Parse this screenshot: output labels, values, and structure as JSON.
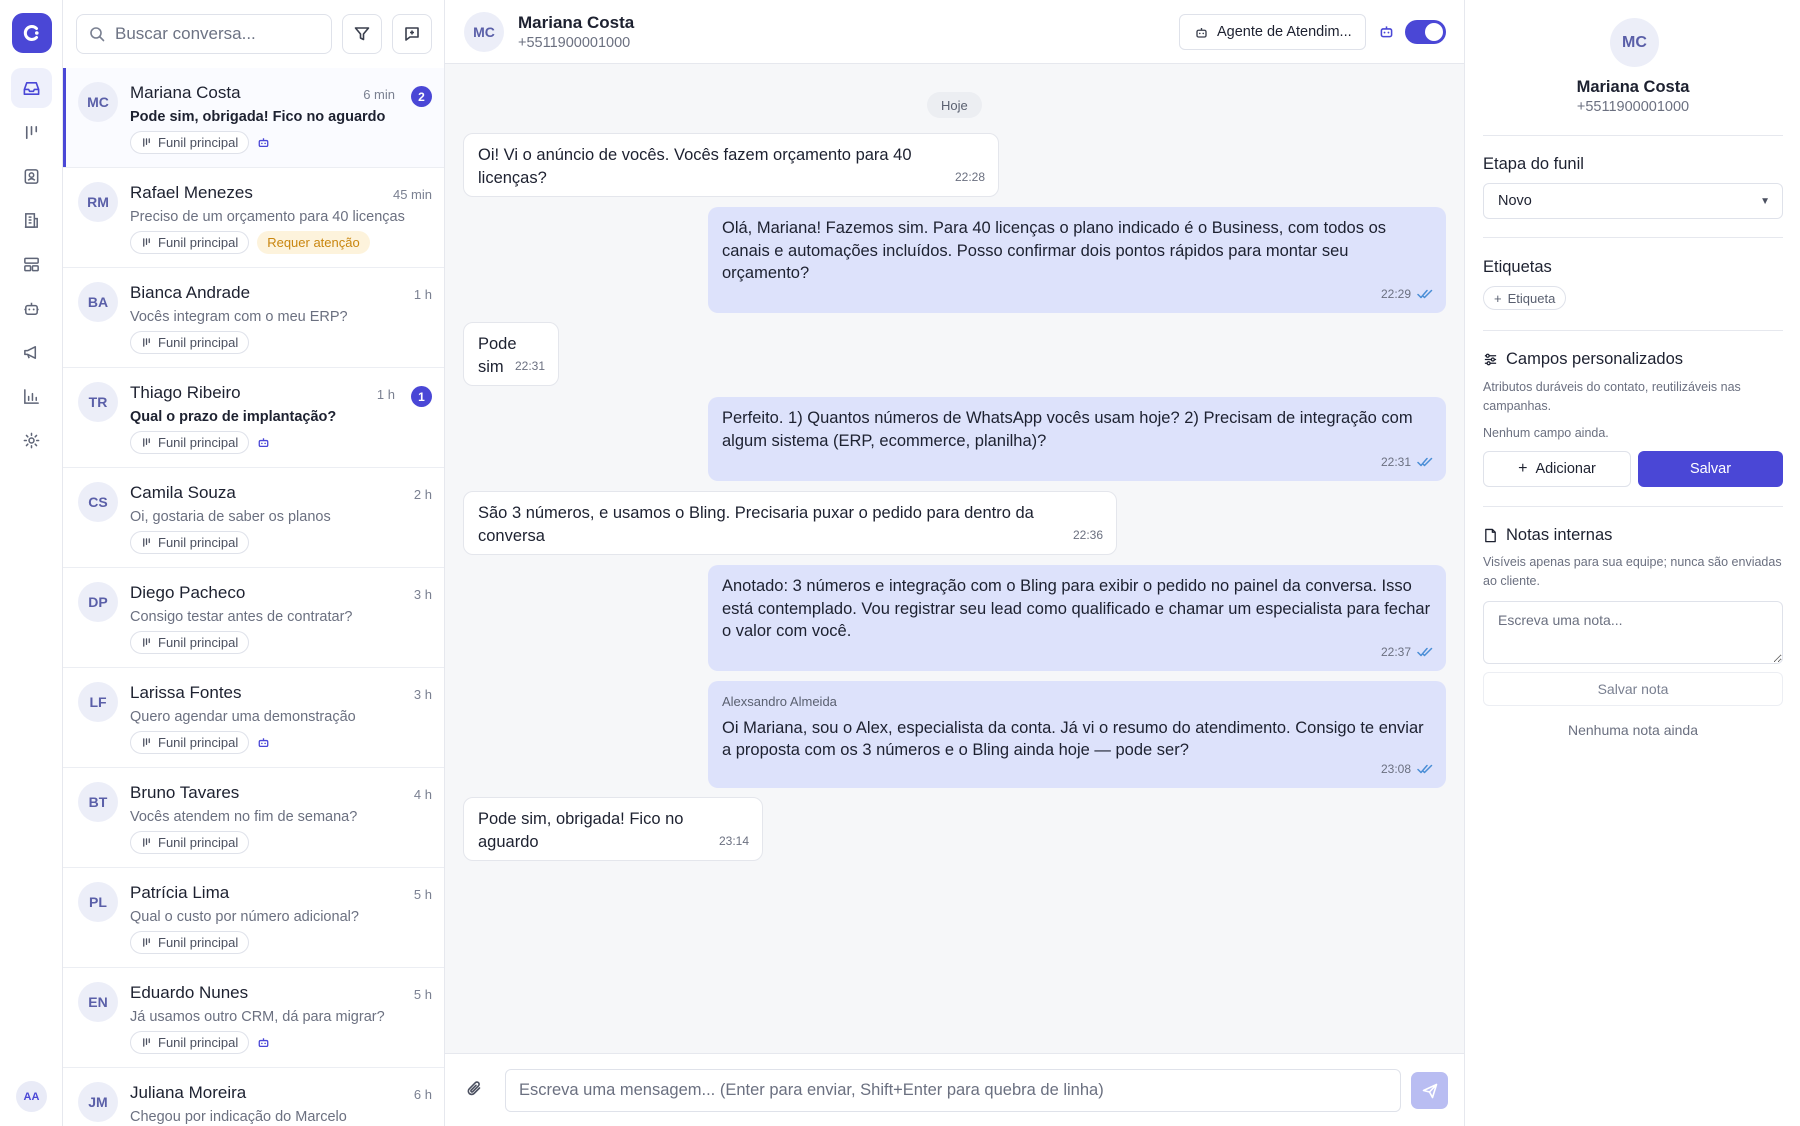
{
  "rail": {
    "nav_icons": [
      "inbox-icon",
      "pipeline-icon",
      "contacts-icon",
      "company-icon",
      "templates-icon",
      "bot-icon",
      "megaphone-icon",
      "reports-icon",
      "gear-icon"
    ],
    "user_initials": "AA"
  },
  "conv_list": {
    "search_placeholder": "Buscar conversa...",
    "items": [
      {
        "initials": "MC",
        "name": "Mariana Costa",
        "time": "6 min",
        "unread": "2",
        "preview": "Pode sim, obrigada! Fico no aguardo",
        "tag": "Funil principal",
        "bot": true,
        "warn": ""
      },
      {
        "initials": "RM",
        "name": "Rafael Menezes",
        "time": "45 min",
        "unread": "",
        "preview": "Preciso de um orçamento para 40 licenças",
        "tag": "Funil principal",
        "bot": false,
        "warn": "Requer atenção"
      },
      {
        "initials": "BA",
        "name": "Bianca Andrade",
        "time": "1 h",
        "unread": "",
        "preview": "Vocês integram com o meu ERP?",
        "tag": "Funil principal",
        "bot": false,
        "warn": ""
      },
      {
        "initials": "TR",
        "name": "Thiago Ribeiro",
        "time": "1 h",
        "unread": "1",
        "preview": "Qual o prazo de implantação?",
        "tag": "Funil principal",
        "bot": true,
        "warn": ""
      },
      {
        "initials": "CS",
        "name": "Camila Souza",
        "time": "2 h",
        "unread": "",
        "preview": "Oi, gostaria de saber os planos",
        "tag": "Funil principal",
        "bot": false,
        "warn": ""
      },
      {
        "initials": "DP",
        "name": "Diego Pacheco",
        "time": "3 h",
        "unread": "",
        "preview": "Consigo testar antes de contratar?",
        "tag": "Funil principal",
        "bot": false,
        "warn": ""
      },
      {
        "initials": "LF",
        "name": "Larissa Fontes",
        "time": "3 h",
        "unread": "",
        "preview": "Quero agendar uma demonstração",
        "tag": "Funil principal",
        "bot": true,
        "warn": ""
      },
      {
        "initials": "BT",
        "name": "Bruno Tavares",
        "time": "4 h",
        "unread": "",
        "preview": "Vocês atendem no fim de semana?",
        "tag": "Funil principal",
        "bot": false,
        "warn": ""
      },
      {
        "initials": "PL",
        "name": "Patrícia Lima",
        "time": "5 h",
        "unread": "",
        "preview": "Qual o custo por número adicional?",
        "tag": "Funil principal",
        "bot": false,
        "warn": ""
      },
      {
        "initials": "EN",
        "name": "Eduardo Nunes",
        "time": "5 h",
        "unread": "",
        "preview": "Já usamos outro CRM, dá para migrar?",
        "tag": "Funil principal",
        "bot": true,
        "warn": ""
      },
      {
        "initials": "JM",
        "name": "Juliana Moreira",
        "time": "6 h",
        "unread": "",
        "preview": "Chegou por indicação do Marcelo",
        "tag": "Funil principal",
        "bot": false,
        "warn": ""
      }
    ]
  },
  "chat": {
    "contact_initials": "MC",
    "contact_name": "Mariana Costa",
    "contact_phone": "+5511900001000",
    "agent_label": "Agente de Atendim...",
    "day_label": "Hoje",
    "messages": [
      {
        "dir": "in",
        "text": "Oi! Vi o anúncio de vocês. Vocês fazem orçamento para 40 licenças?",
        "time": "22:28"
      },
      {
        "dir": "out",
        "text": "Olá, Mariana! Fazemos sim. Para 40 licenças o plano indicado é o Business, com todos os canais e automações incluídos. Posso confirmar dois pontos rápidos para montar seu orçamento?",
        "time": "22:29"
      },
      {
        "dir": "in",
        "text": "Pode sim",
        "time": "22:31"
      },
      {
        "dir": "out",
        "text": "Perfeito. 1) Quantos números de WhatsApp vocês usam hoje? 2) Precisam de integração com algum sistema (ERP, ecommerce, planilha)?",
        "time": "22:31"
      },
      {
        "dir": "in",
        "text": "São 3 números, e usamos o Bling. Precisaria puxar o pedido para dentro da conversa",
        "time": "22:36"
      },
      {
        "dir": "out",
        "text": "Anotado: 3 números e integração com o Bling para exibir o pedido no painel da conversa. Isso está contemplado. Vou registrar seu lead como qualificado e chamar um especialista para fechar o valor com você.",
        "time": "22:37"
      },
      {
        "dir": "out",
        "author": "Alexsandro Almeida",
        "text": "Oi Mariana, sou o Alex, especialista da conta. Já vi o resumo do atendimento. Consigo te enviar a proposta com os 3 números e o Bling ainda hoje — pode ser?",
        "time": "23:08"
      },
      {
        "dir": "in",
        "text": "Pode sim, obrigada! Fico no aguardo",
        "time": "23:14"
      }
    ],
    "composer_placeholder": "Escreva uma mensagem... (Enter para enviar, Shift+Enter para quebra de linha)"
  },
  "panel": {
    "initials": "MC",
    "name": "Mariana Costa",
    "phone": "+5511900001000",
    "funnel_title": "Etapa do funil",
    "funnel_value": "Novo",
    "tags_title": "Etiquetas",
    "add_tag_label": "Etiqueta",
    "custom_fields_title": "Campos personalizados",
    "custom_fields_hint": "Atributos duráveis do contato, reutilizáveis nas campanhas.",
    "custom_fields_empty": "Nenhum campo ainda.",
    "add_label": "Adicionar",
    "save_label": "Salvar",
    "notes_title": "Notas internas",
    "notes_hint": "Visíveis apenas para sua equipe; nunca são enviadas ao cliente.",
    "note_placeholder": "Escreva uma nota...",
    "save_note_label": "Salvar nota",
    "no_notes": "Nenhuma nota ainda"
  },
  "colors": {
    "accent": "#4a47d6",
    "outgoing_bubble": "#dde2fb",
    "warn_text": "#c9860f",
    "warn_bg": "#fdf3dc"
  }
}
